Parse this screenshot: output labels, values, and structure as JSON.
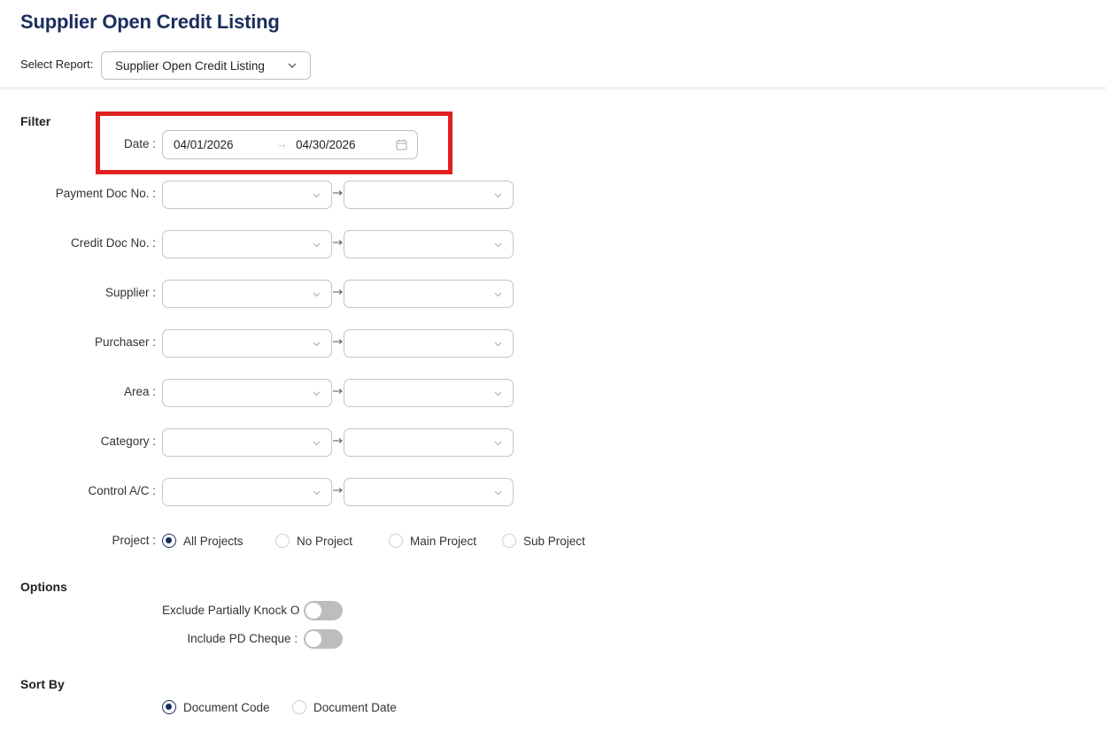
{
  "page": {
    "title": "Supplier Open Credit Listing"
  },
  "report": {
    "label": "Select Report:",
    "selected": "Supplier Open Credit Listing"
  },
  "filter": {
    "heading": "Filter",
    "date": {
      "label": "Date :",
      "from": "04/01/2026",
      "to": "04/30/2026"
    },
    "ranges": [
      {
        "label": "Payment Doc No. :"
      },
      {
        "label": "Credit Doc No. :"
      },
      {
        "label": "Supplier :"
      },
      {
        "label": "Purchaser :"
      },
      {
        "label": "Area :"
      },
      {
        "label": "Category :"
      },
      {
        "label": "Control A/C :"
      }
    ],
    "project": {
      "label": "Project :",
      "options": [
        "All Projects",
        "No Project",
        "Main Project",
        "Sub Project"
      ],
      "selected": "All Projects"
    }
  },
  "options": {
    "heading": "Options",
    "toggles": [
      {
        "label": "Exclude Partially Knock O",
        "on": false
      },
      {
        "label": "Include PD Cheque :",
        "on": false
      }
    ]
  },
  "sort": {
    "heading": "Sort By",
    "options": [
      "Document Code",
      "Document Date"
    ],
    "selected": "Document Code"
  },
  "colors": {
    "title": "#1a2e5c",
    "highlight": "#e02020",
    "radio": "#1a2e5c",
    "toggle_off": "#bdbdbd"
  },
  "icons": {
    "report_select": "chevron-down-icon",
    "date": "calendar-icon",
    "dropdown": "chevron-down-icon"
  }
}
